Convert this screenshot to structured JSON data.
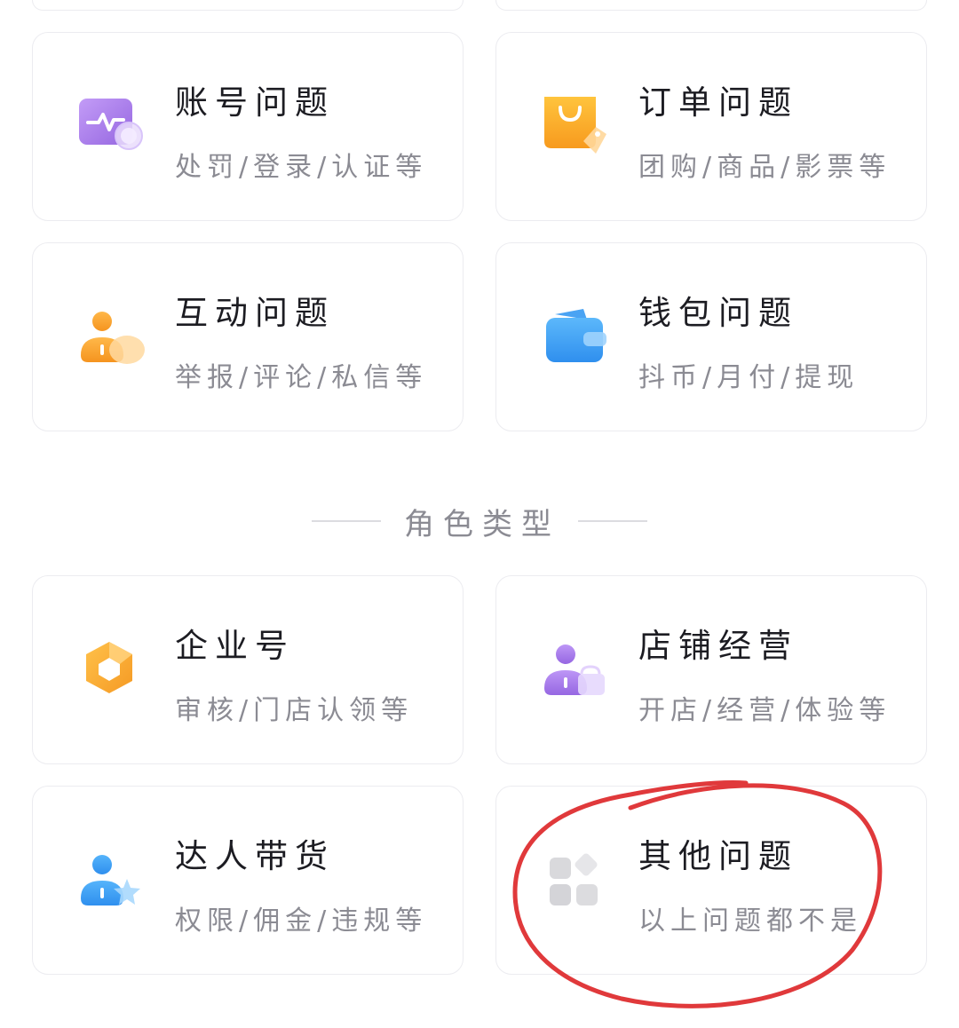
{
  "problem_types": [
    {
      "title": "账号问题",
      "subtitle": "处罚/登录/认证等",
      "icon": "account-activity-icon"
    },
    {
      "title": "订单问题",
      "subtitle": "团购/商品/影票等",
      "icon": "shopping-bag-icon"
    },
    {
      "title": "互动问题",
      "subtitle": "举报/评论/私信等",
      "icon": "user-chat-icon"
    },
    {
      "title": "钱包问题",
      "subtitle": "抖币/月付/提现",
      "icon": "wallet-icon"
    }
  ],
  "section": {
    "heading": "角色类型"
  },
  "role_types": [
    {
      "title": "企业号",
      "subtitle": "审核/门店认领等",
      "icon": "enterprise-cube-icon"
    },
    {
      "title": "店铺经营",
      "subtitle": "开店/经营/体验等",
      "icon": "shop-owner-icon"
    },
    {
      "title": "达人带货",
      "subtitle": "权限/佣金/违规等",
      "icon": "creator-star-icon"
    },
    {
      "title": "其他问题",
      "subtitle": "以上问题都不是",
      "icon": "grid-apps-icon"
    }
  ],
  "colors": {
    "annotation": "#e0393b",
    "purple": "#a77ce8",
    "orange": "#f7a02a",
    "blue": "#3a9cf0",
    "gray": "#d6d6d9"
  }
}
